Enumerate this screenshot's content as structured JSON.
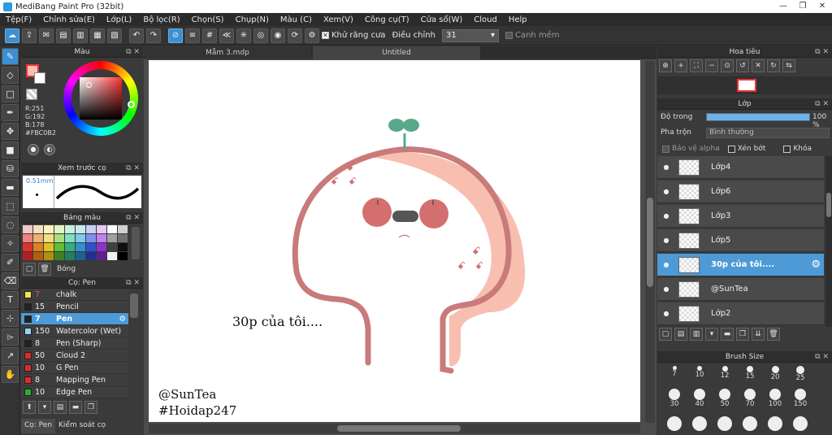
{
  "window": {
    "title": "MediBang Paint Pro (32bit)",
    "controls": [
      "—",
      "❐",
      "✕"
    ]
  },
  "menu": [
    "Tệp(F)",
    "Chỉnh sửa(E)",
    "Lớp(L)",
    "Bộ lọc(R)",
    "Chọn(S)",
    "Chụp(N)",
    "Màu (C)",
    "Xem(V)",
    "Công cụ(T)",
    "Cửa sổ(W)",
    "Cloud",
    "Help"
  ],
  "toolbar": {
    "antialias_label": "Khử răng cưa",
    "antialias_check": "✕",
    "adjust_label": "Điều chỉnh",
    "adjust_value": "31",
    "adjust_arrow": "▾",
    "smooth_edge_label": "Cạnh mềm"
  },
  "color_panel": {
    "title": "Màu",
    "r": "R:251",
    "g": "G:192",
    "b": "B:178",
    "hex": "#FBC0B2",
    "accent": "#FBC0B2"
  },
  "brush_preview": {
    "title": "Xem trước cọ",
    "size": "0.51mm"
  },
  "palette": {
    "title": "Bảng màu",
    "shadow_label": "Bóng",
    "colors": [
      "#f4c8c8",
      "#f7e0c0",
      "#fff2c0",
      "#e0f4c8",
      "#c8f0e0",
      "#c8e8f4",
      "#c8d0f4",
      "#e8c8f4",
      "#ffffff",
      "#d0d0d0",
      "#f08080",
      "#f0b070",
      "#f0e080",
      "#a8e080",
      "#80e0c0",
      "#80c8f0",
      "#8090f0",
      "#c080f0",
      "#a0a0a0",
      "#707070",
      "#e03030",
      "#e08020",
      "#e0c020",
      "#60c030",
      "#30b080",
      "#3090d0",
      "#3050d0",
      "#9030d0",
      "#404040",
      "#101010",
      "#b02020",
      "#b06010",
      "#b09010",
      "#408020",
      "#208060",
      "#206090",
      "#203090",
      "#602090",
      "#f0f0f0",
      "#000000"
    ]
  },
  "brush_list": {
    "title": "Cọ: Pen",
    "items": [
      {
        "size": "7",
        "name": "chalk",
        "color": "#f5e14a"
      },
      {
        "size": "15",
        "name": "Pencil",
        "color": "#222222"
      },
      {
        "size": "7",
        "name": "Pen",
        "color": "#222222"
      },
      {
        "size": "150",
        "name": "Watercolor (Wet)",
        "color": "#8fd6f5"
      },
      {
        "size": "8",
        "name": "Pen (Sharp)",
        "color": "#222222"
      },
      {
        "size": "50",
        "name": "Cloud 2",
        "color": "#e02a2a"
      },
      {
        "size": "10",
        "name": "G Pen",
        "color": "#e02a2a"
      },
      {
        "size": "8",
        "name": "Mapping Pen",
        "color": "#e02a2a"
      },
      {
        "size": "10",
        "name": "Edge Pen",
        "color": "#2ab02a"
      }
    ],
    "bottom_tabs": [
      "Cọ: Pen",
      "Kiểm soát cọ"
    ]
  },
  "tabs": [
    "Mẫm 3.mdp",
    "Untitled"
  ],
  "canvas": {
    "text_main": "30p của tôi....",
    "sign_1": "@SunTea",
    "sign_2": "#Hoidap247",
    "angry_mark": "ꗃ"
  },
  "navigator": {
    "title": "Hoa tiêu"
  },
  "layer_panel": {
    "title": "Lớp",
    "opacity_label": "Độ trong",
    "opacity_value": "100 %",
    "opacity_pct": 100,
    "blend_label": "Pha trộn",
    "blend_value": "Bình thường",
    "alpha_lock": "Bảo vệ alpha",
    "clip": "Xén bớt",
    "lock": "Khóa",
    "layers": [
      {
        "name": "Lớp4"
      },
      {
        "name": "Lớp6"
      },
      {
        "name": "Lớp3"
      },
      {
        "name": "Lớp5"
      },
      {
        "name": "30p của tôi...."
      },
      {
        "name": "@SunTea"
      },
      {
        "name": "Lớp2"
      }
    ]
  },
  "brush_size": {
    "title": "Brush Size",
    "row1": [
      "7",
      "10",
      "12",
      "15",
      "20",
      "25"
    ],
    "row2": [
      "30",
      "40",
      "50",
      "70",
      "100",
      "150"
    ]
  },
  "colors": {
    "outline": "#c97a7a",
    "shadow": "#f6b8a8",
    "cheek": "#d36f6f",
    "sprout": "#5aa88a",
    "selection": "#4d9ad6"
  }
}
